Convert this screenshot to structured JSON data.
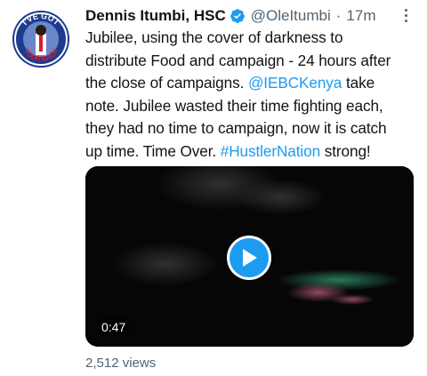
{
  "tweet": {
    "author_name": "Dennis Itumbi, HSC",
    "handle": "@OleItumbi",
    "separator": "·",
    "time": "17m",
    "avatar_text": [
      "I'VE GOT",
      "YOUR BACK"
    ],
    "text_lines": [
      [
        {
          "t": "Jubilee, using the cover of darkness to"
        }
      ],
      [
        {
          "t": "distribute Food and campaign - 24 hours after"
        }
      ],
      [
        {
          "t": "the close of campaigns. "
        },
        {
          "t": "@IEBCKenya",
          "link": true
        },
        {
          "t": " take"
        }
      ],
      [
        {
          "t": "note. Jubilee wasted their time fighting each,"
        }
      ],
      [
        {
          "t": "they had no time to campaign, now it is catch"
        }
      ],
      [
        {
          "t": "up time. Time Over. "
        },
        {
          "t": "#HustlerNation",
          "link": true
        },
        {
          "t": " strong!"
        }
      ]
    ]
  },
  "media": {
    "duration": "0:47",
    "play_icon": "play-icon"
  },
  "stats": {
    "views": "2,512 views"
  },
  "colors": {
    "link": "#1d9bf0",
    "verified": "#1d9bf0",
    "secondary_text": "#536471",
    "avatar_bg": "#1d3c8f",
    "avatar_ring": "#d4202a"
  }
}
